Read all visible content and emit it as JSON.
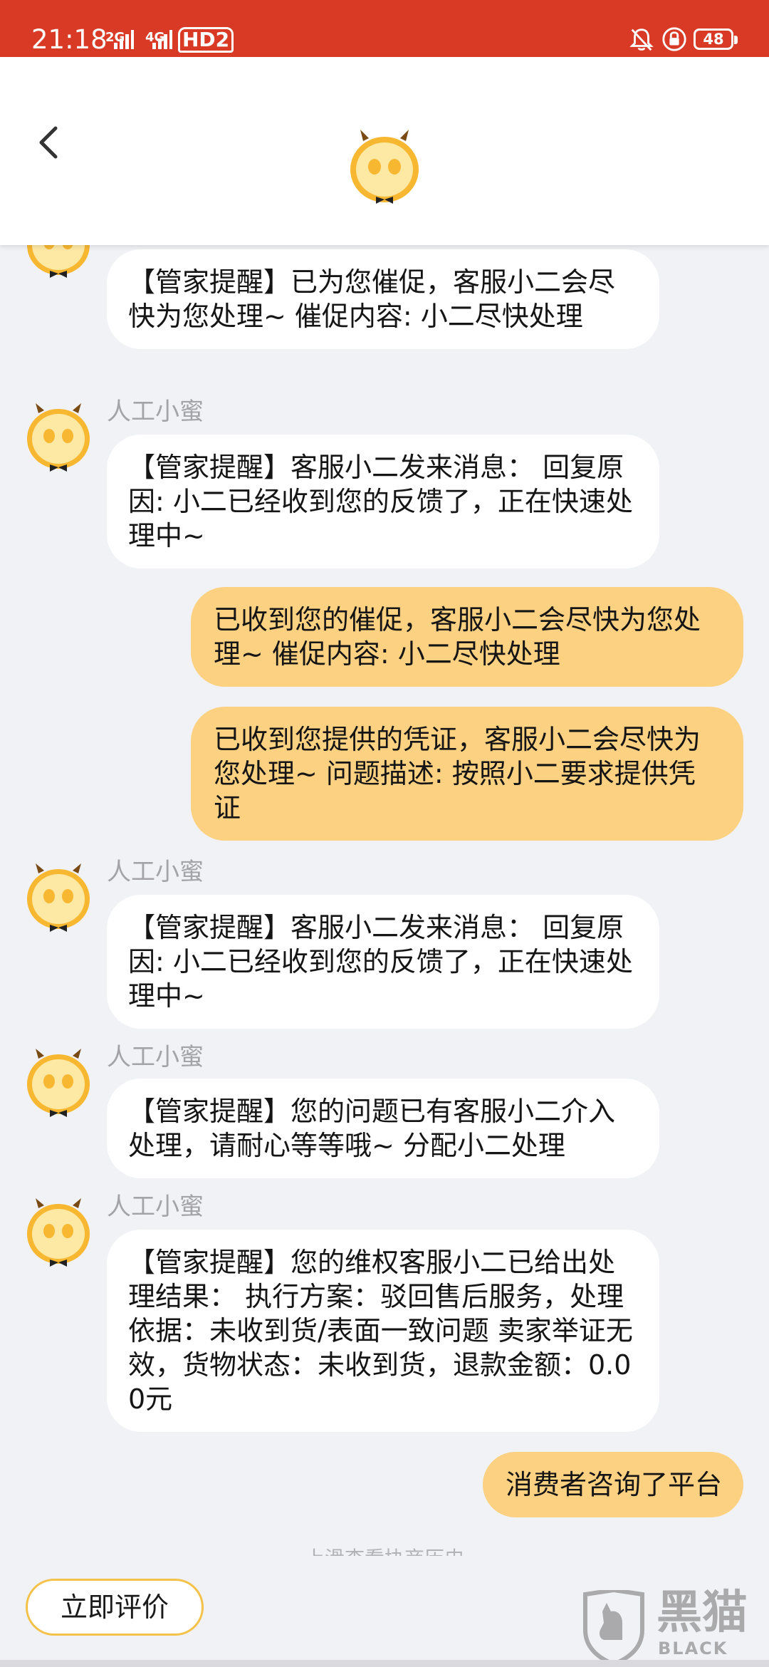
{
  "status_bar": {
    "time": "21:18",
    "signal_1": "2G",
    "signal_2": "4G",
    "hd_label": "HD2",
    "battery": "48"
  },
  "header": {
    "back_icon": "chevron-left-icon",
    "logo_icon": "xiaomi-mascot-icon"
  },
  "chat": {
    "messages": [
      {
        "side": "left",
        "sender": "",
        "text": "【管家提醒】已为您催促，客服小二会尽快为您处理~ 催促内容: 小二尽快处理"
      },
      {
        "side": "left",
        "sender": "人工小蜜",
        "text": "【管家提醒】客服小二发来消息： 回复原因: 小二已经收到您的反馈了，正在快速处理中~"
      },
      {
        "side": "right",
        "text": "已收到您的催促，客服小二会尽快为您处理~ 催促内容: 小二尽快处理"
      },
      {
        "side": "right",
        "text": "已收到您提供的凭证，客服小二会尽快为您处理~ 问题描述: 按照小二要求提供凭证"
      },
      {
        "side": "left",
        "sender": "人工小蜜",
        "text": "【管家提醒】客服小二发来消息： 回复原因: 小二已经收到您的反馈了，正在快速处理中~"
      },
      {
        "side": "left",
        "sender": "人工小蜜",
        "text": "【管家提醒】您的问题已有客服小二介入处理，请耐心等等哦~ 分配小二处理"
      },
      {
        "side": "left",
        "sender": "人工小蜜",
        "text": "【管家提醒】您的维权客服小二已给出处理结果： 执行方案：驳回售后服务，处理依据：未收到货/表面一致问题 卖家举证无效，货物状态：未收到货，退款金额：0.00元"
      },
      {
        "side": "right",
        "text": "消费者咨询了平台"
      }
    ],
    "history_hint": "上滑查看协商历史"
  },
  "bottom": {
    "rate_label": "立即评价"
  },
  "watermark": {
    "main": "黑猫",
    "sub": "BLACK CAT"
  },
  "colors": {
    "status_bar": "#d93a26",
    "bubble_user": "#fcd182",
    "bubble_agent": "#ffffff",
    "background": "#f1f2f6",
    "rate_border": "#f4c14a"
  }
}
